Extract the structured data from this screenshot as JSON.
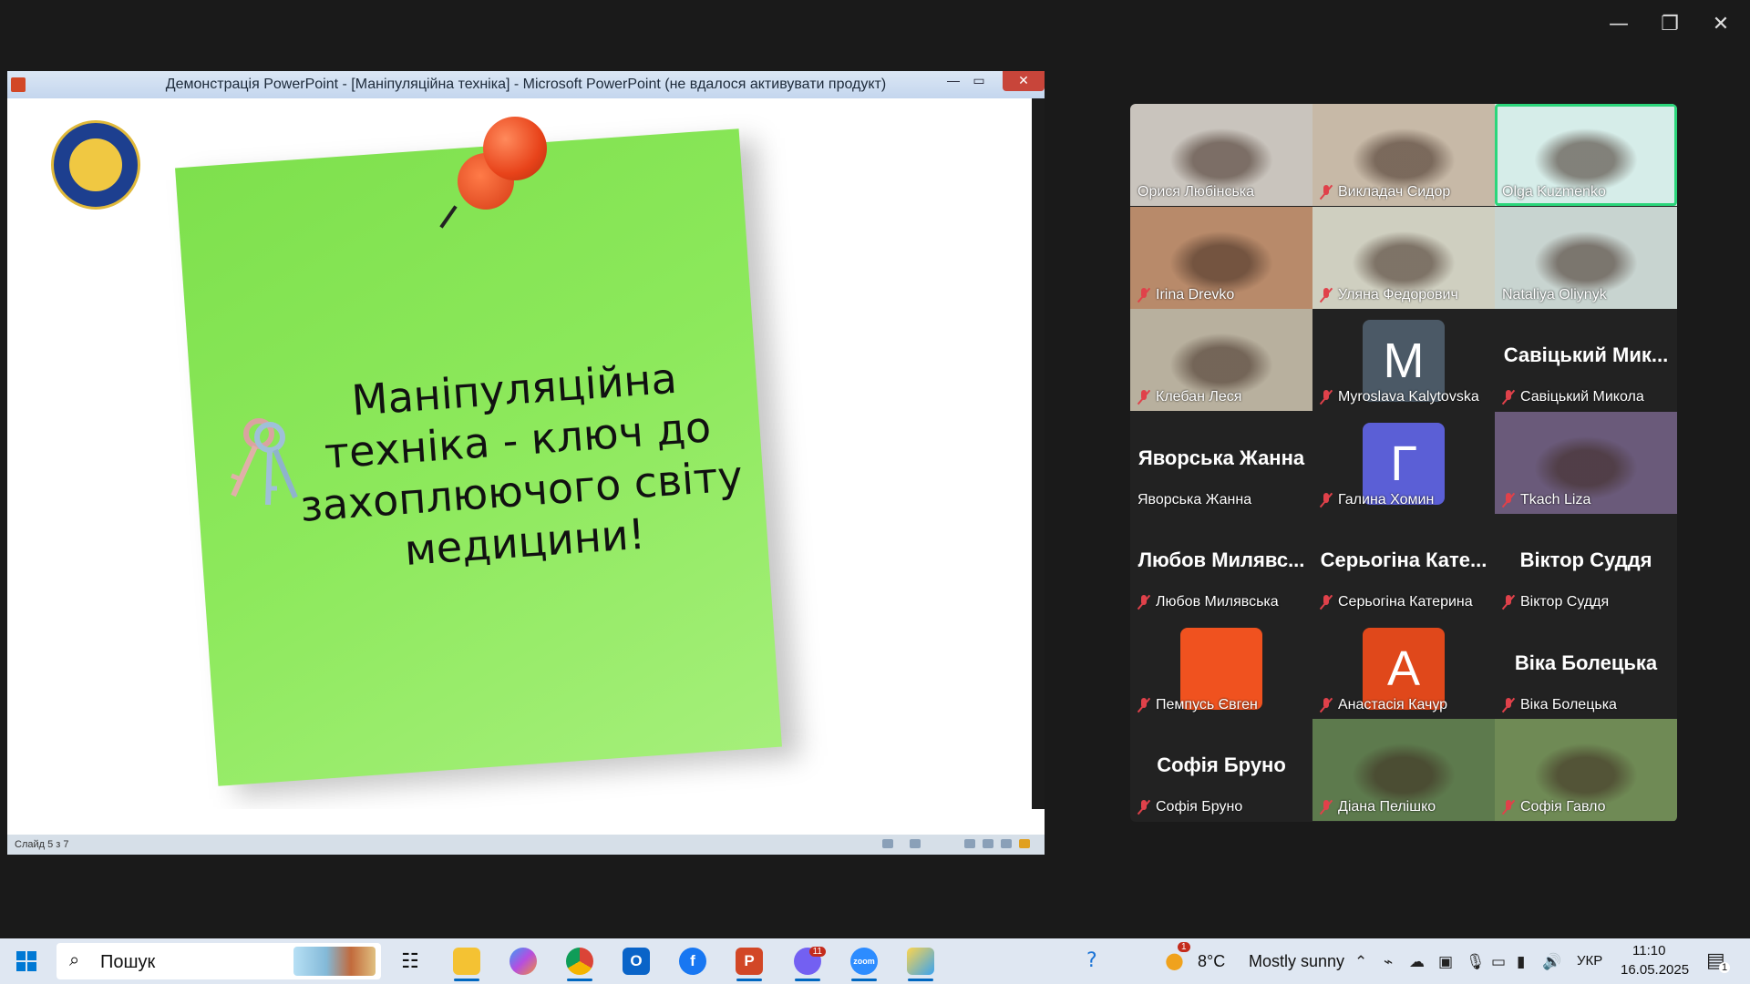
{
  "zoom_window": {
    "minimize_icon": "minimize-icon",
    "restore_icon": "restore-icon",
    "close_icon": "close-icon"
  },
  "powerpoint": {
    "title": "Демонстрація PowerPoint - [Маніпуляційна техніка] - Microsoft PowerPoint (не вдалося активувати продукт)",
    "slide_text": "Маніпуляційна техніка - ключ до захоплюючого світу медицини!",
    "status_slide": "Слайд 5 з 7"
  },
  "participants": [
    {
      "name": "Орися Любінська",
      "muted": false,
      "type": "video",
      "bg": "#c9c4bd"
    },
    {
      "name": "Викладач Сидор",
      "muted": true,
      "type": "video",
      "bg": "#c7b9a7"
    },
    {
      "name": "Olga Kuzmenko",
      "muted": false,
      "type": "video",
      "bg": "#d6ede9",
      "active": true
    },
    {
      "name": "Irina Drevko",
      "muted": true,
      "type": "video",
      "bg": "#b88a6a"
    },
    {
      "name": "Уляна Федорович",
      "muted": true,
      "type": "video",
      "bg": "#cfcfc0"
    },
    {
      "name": "Nataliya Oliynyk",
      "muted": false,
      "type": "video",
      "bg": "#c8d4d0"
    },
    {
      "name": "Клебан Леся",
      "muted": true,
      "type": "video",
      "bg": "#b8b09e"
    },
    {
      "name": "Myroslava Kalytovska",
      "muted": true,
      "type": "avatar",
      "letter": "M",
      "color": "#4b5966"
    },
    {
      "name": "Савіцький Микола",
      "muted": true,
      "type": "text",
      "display": "Савіцький Мик..."
    },
    {
      "name": "Яворська Жанна",
      "muted": false,
      "type": "text",
      "display": "Яворська Жанна"
    },
    {
      "name": "Галина Хомин",
      "muted": true,
      "type": "avatar",
      "letter": "Г",
      "color": "#5b5fd6"
    },
    {
      "name": "Tkach Liza",
      "muted": true,
      "type": "video",
      "bg": "#6a5a7a"
    },
    {
      "name": "Любов Милявська",
      "muted": true,
      "type": "text",
      "display": "Любов Милявс..."
    },
    {
      "name": "Серьогіна Катерина",
      "muted": true,
      "type": "text",
      "display": "Серьогіна Кате..."
    },
    {
      "name": "Віктор Суддя",
      "muted": true,
      "type": "text",
      "display": "Віктор Суддя"
    },
    {
      "name": "Пемпусь Євген",
      "muted": true,
      "type": "avatar",
      "letter": "",
      "color": "#f0521f"
    },
    {
      "name": "Анастасія Качур",
      "muted": true,
      "type": "avatar",
      "letter": "A",
      "color": "#e0481b"
    },
    {
      "name": "Віка Болецька",
      "muted": true,
      "type": "text",
      "display": "Віка Болецька"
    },
    {
      "name": "Софія Бруно",
      "muted": true,
      "type": "text",
      "display": "Софія Бруно"
    },
    {
      "name": "Діана Пелішко",
      "muted": true,
      "type": "video",
      "bg": "#5d7a4d"
    },
    {
      "name": "Софія Гавло",
      "muted": true,
      "type": "video",
      "bg": "#6f8a55"
    }
  ],
  "taskbar": {
    "search_placeholder": "Пошук",
    "weather_temp": "8°C",
    "weather_text": "Mostly sunny",
    "weather_badge": "1",
    "lang": "УКР",
    "time": "11:10",
    "date": "16.05.2025",
    "notification_count": "1",
    "teams_badge": "11",
    "apps": [
      "task-view",
      "file-explorer",
      "copilot",
      "chrome",
      "outlook",
      "facebook",
      "powerpoint",
      "viber",
      "zoom",
      "photos"
    ],
    "help_icon": "help-icon"
  }
}
